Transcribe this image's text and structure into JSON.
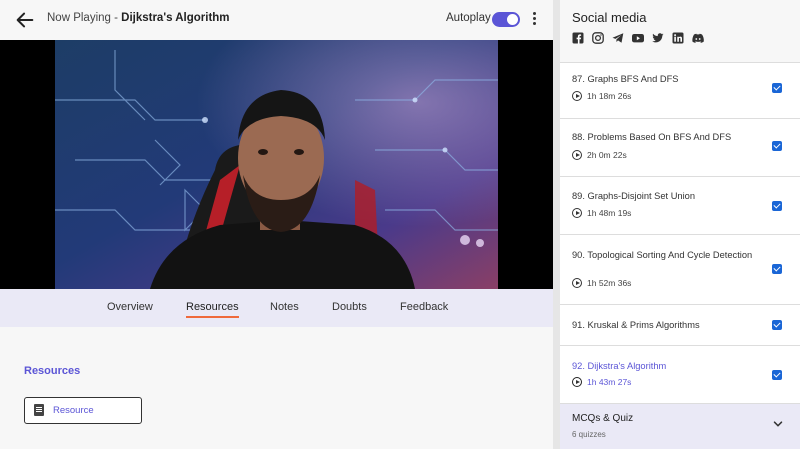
{
  "header": {
    "now_playing_prefix": "Now Playing - ",
    "video_title": "Dijkstra's Algorithm",
    "autoplay_label": "Autoplay",
    "autoplay_on": true
  },
  "tabs": [
    {
      "label": "Overview",
      "active": false
    },
    {
      "label": "Resources",
      "active": true
    },
    {
      "label": "Notes",
      "active": false
    },
    {
      "label": "Doubts",
      "active": false
    },
    {
      "label": "Feedback",
      "active": false
    }
  ],
  "resources": {
    "heading": "Resources",
    "button_label": "Resource"
  },
  "sidebar": {
    "social_title": "Social media",
    "social_icons": [
      "facebook-icon",
      "instagram-icon",
      "telegram-icon",
      "youtube-icon",
      "twitter-icon",
      "linkedin-icon",
      "discord-icon"
    ],
    "lessons": [
      {
        "title": "87. Graphs BFS And DFS",
        "duration": "1h 18m 26s",
        "completed": true,
        "current": false
      },
      {
        "title": "88. Problems Based On BFS And DFS",
        "duration": "2h 0m 22s",
        "completed": true,
        "current": false
      },
      {
        "title": "89. Graphs-Disjoint Set Union",
        "duration": "1h 48m 19s",
        "completed": true,
        "current": false
      },
      {
        "title": "90. Topological Sorting And Cycle Detection",
        "duration": "1h 52m 36s",
        "completed": true,
        "current": false
      },
      {
        "title": "91. Kruskal & Prims Algorithms",
        "duration": "",
        "completed": true,
        "current": false
      },
      {
        "title": "92. Dijkstra's Algorithm",
        "duration": "1h 43m 27s",
        "completed": true,
        "current": true
      }
    ],
    "quiz": {
      "title": "MCQs & Quiz",
      "subtitle": "6 quizzes"
    }
  },
  "colors": {
    "accent": "#5b55d6",
    "tab_underline": "#ef6a3c",
    "checkbox": "#1a66d6",
    "tab_bar_bg": "#eae9f6"
  }
}
